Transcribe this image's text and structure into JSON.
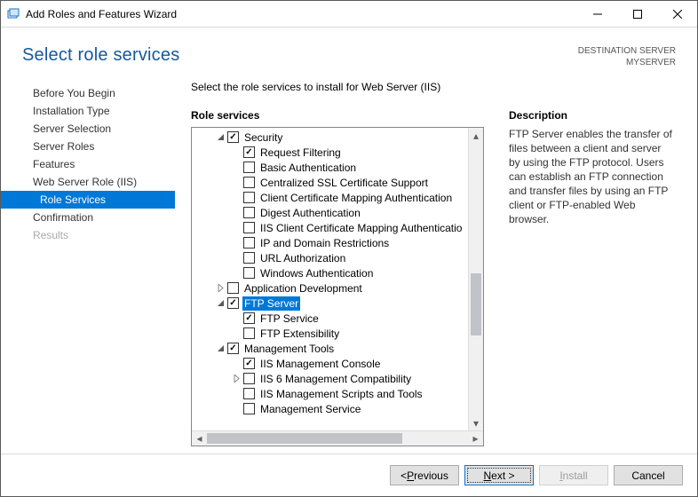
{
  "window": {
    "title": "Add Roles and Features Wizard"
  },
  "header": {
    "heading": "Select role services",
    "dest_label": "DESTINATION SERVER",
    "dest_value": "MYSERVER"
  },
  "nav": {
    "items": [
      {
        "label": "Before You Begin",
        "selected": false
      },
      {
        "label": "Installation Type",
        "selected": false
      },
      {
        "label": "Server Selection",
        "selected": false
      },
      {
        "label": "Server Roles",
        "selected": false
      },
      {
        "label": "Features",
        "selected": false
      },
      {
        "label": "Web Server Role (IIS)",
        "selected": false
      },
      {
        "label": "Role Services",
        "selected": true,
        "sub": true
      },
      {
        "label": "Confirmation",
        "selected": false
      },
      {
        "label": "Results",
        "selected": false,
        "disabled": true
      }
    ]
  },
  "main": {
    "instruction": "Select the role services to install for Web Server (IIS)",
    "tree_title": "Role services",
    "tree": [
      {
        "indent": 0,
        "exp": "open",
        "checked": true,
        "label": "Security"
      },
      {
        "indent": 1,
        "checked": true,
        "label": "Request Filtering"
      },
      {
        "indent": 1,
        "checked": false,
        "label": "Basic Authentication"
      },
      {
        "indent": 1,
        "checked": false,
        "label": "Centralized SSL Certificate Support"
      },
      {
        "indent": 1,
        "checked": false,
        "label": "Client Certificate Mapping Authentication"
      },
      {
        "indent": 1,
        "checked": false,
        "label": "Digest Authentication"
      },
      {
        "indent": 1,
        "checked": false,
        "label": "IIS Client Certificate Mapping Authenticatio"
      },
      {
        "indent": 1,
        "checked": false,
        "label": "IP and Domain Restrictions"
      },
      {
        "indent": 1,
        "checked": false,
        "label": "URL Authorization"
      },
      {
        "indent": 1,
        "checked": false,
        "label": "Windows Authentication"
      },
      {
        "indent": 0,
        "exp": "closed",
        "checked": false,
        "label": "Application Development"
      },
      {
        "indent": 0,
        "exp": "open",
        "checked": true,
        "label": "FTP Server",
        "highlight": true
      },
      {
        "indent": 1,
        "checked": true,
        "label": "FTP Service"
      },
      {
        "indent": 1,
        "checked": false,
        "label": "FTP Extensibility"
      },
      {
        "indent": 0,
        "exp": "open",
        "checked": true,
        "label": "Management Tools"
      },
      {
        "indent": 1,
        "checked": true,
        "label": "IIS Management Console"
      },
      {
        "indent": 1,
        "exp": "closed",
        "checked": false,
        "label": "IIS 6 Management Compatibility"
      },
      {
        "indent": 1,
        "checked": false,
        "label": "IIS Management Scripts and Tools"
      },
      {
        "indent": 1,
        "checked": false,
        "label": "Management Service"
      }
    ],
    "desc_title": "Description",
    "desc_body": "FTP Server enables the transfer of files between a client and server by using the FTP protocol. Users can establish an FTP connection and transfer files by using an FTP client or FTP-enabled Web browser."
  },
  "footer": {
    "previous": "Previous",
    "next": "Next >",
    "install": "Install",
    "cancel": "Cancel"
  }
}
